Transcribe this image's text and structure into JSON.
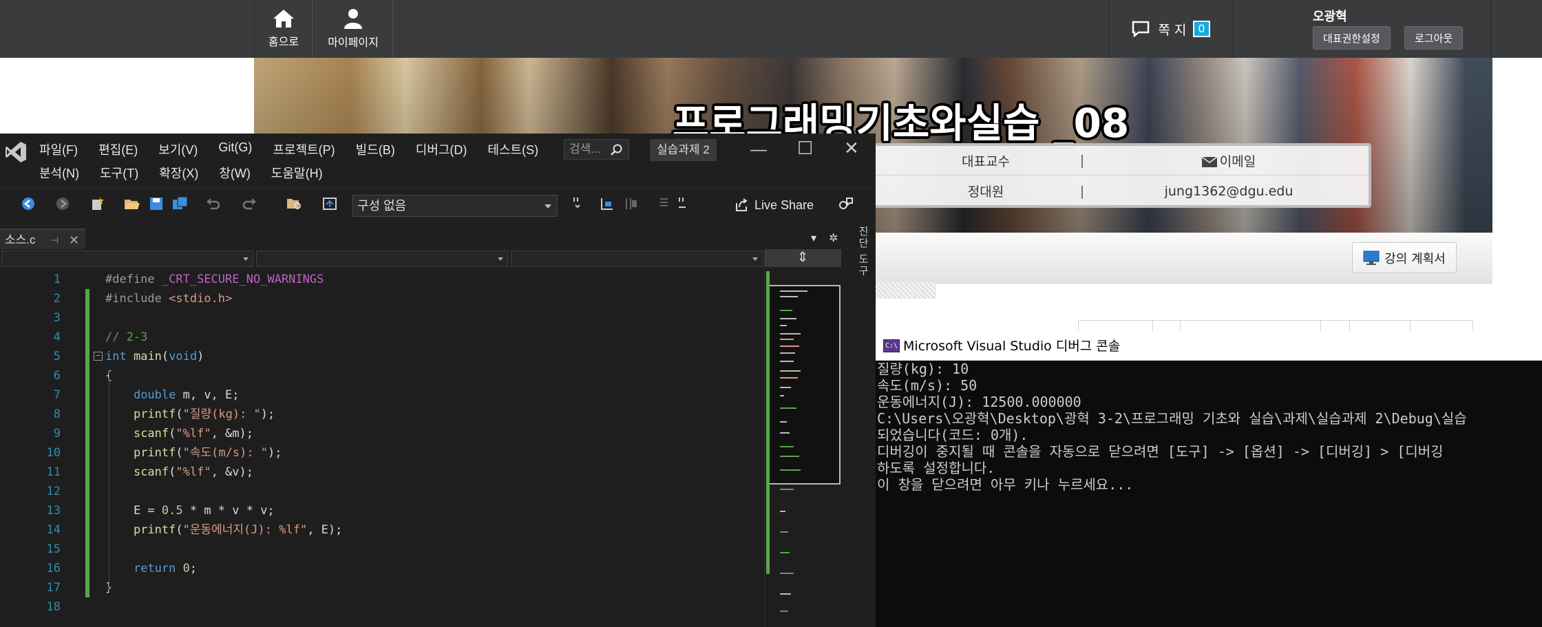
{
  "website": {
    "nav": {
      "home_label": "홈으로",
      "mypage_label": "마이페이지"
    },
    "messages": {
      "label": "쪽 지",
      "count": "0"
    },
    "user": {
      "name": "오광혁",
      "role_button": "대표권한설정",
      "logout_button": "로그아웃"
    },
    "course_title": "프로그래밍기초와실습 _08",
    "info": {
      "head_left": "대표교수",
      "head_right": "이메일",
      "name": "정대원",
      "email": "jung1362@dgu.edu"
    },
    "plan_button": "강의 계획서"
  },
  "vs": {
    "menu_row1": [
      "파일(F)",
      "편집(E)",
      "보기(V)",
      "Git(G)",
      "프로젝트(P)",
      "빌드(B)",
      "디버그(D)",
      "테스트(S)"
    ],
    "menu_row2": [
      "분석(N)",
      "도구(T)",
      "확장(X)",
      "창(W)",
      "도움말(H)"
    ],
    "search_placeholder": "검색...",
    "solution_name": "실습과제 2",
    "config_value": "구성 없음",
    "live_share": "Live Share",
    "file_tab": "소스.c",
    "side_tool": "진단 도구",
    "line_numbers": [
      "1",
      "2",
      "3",
      "4",
      "5",
      "6",
      "7",
      "8",
      "9",
      "10",
      "11",
      "12",
      "13",
      "14",
      "15",
      "16",
      "17",
      "18"
    ],
    "code_lines": [
      "#define _CRT_SECURE_NO_WARNINGS",
      "#include <stdio.h>",
      "",
      "// 2-3",
      "int main(void)",
      "{",
      "    double m, v, E;",
      "    printf(\"질량(kg): \");",
      "    scanf(\"%lf\", &m);",
      "    printf(\"속도(m/s): \");",
      "    scanf(\"%lf\", &v);",
      "",
      "    E = 0.5 * m * v * v;",
      "    printf(\"운동에너지(J): %lf\", E);",
      "",
      "    return 0;",
      "}",
      ""
    ]
  },
  "console": {
    "title": "Microsoft Visual Studio 디버그 콘솔",
    "lines": [
      "질량(kg): 10",
      "속도(m/s): 50",
      "운동에너지(J): 12500.000000",
      "C:\\Users\\오광혁\\Desktop\\광혁 3-2\\프로그래밍 기초와 실습\\과제\\실습과제 2\\Debug\\실습",
      "되었습니다(코드: 0개).",
      "디버깅이 중지될 때 콘솔을 자동으로 닫으려면 [도구] -> [옵션] -> [디버깅] > [디버깅",
      "하도록 설정합니다.",
      "이 창을 닫으려면 아무 키나 누르세요..."
    ]
  }
}
